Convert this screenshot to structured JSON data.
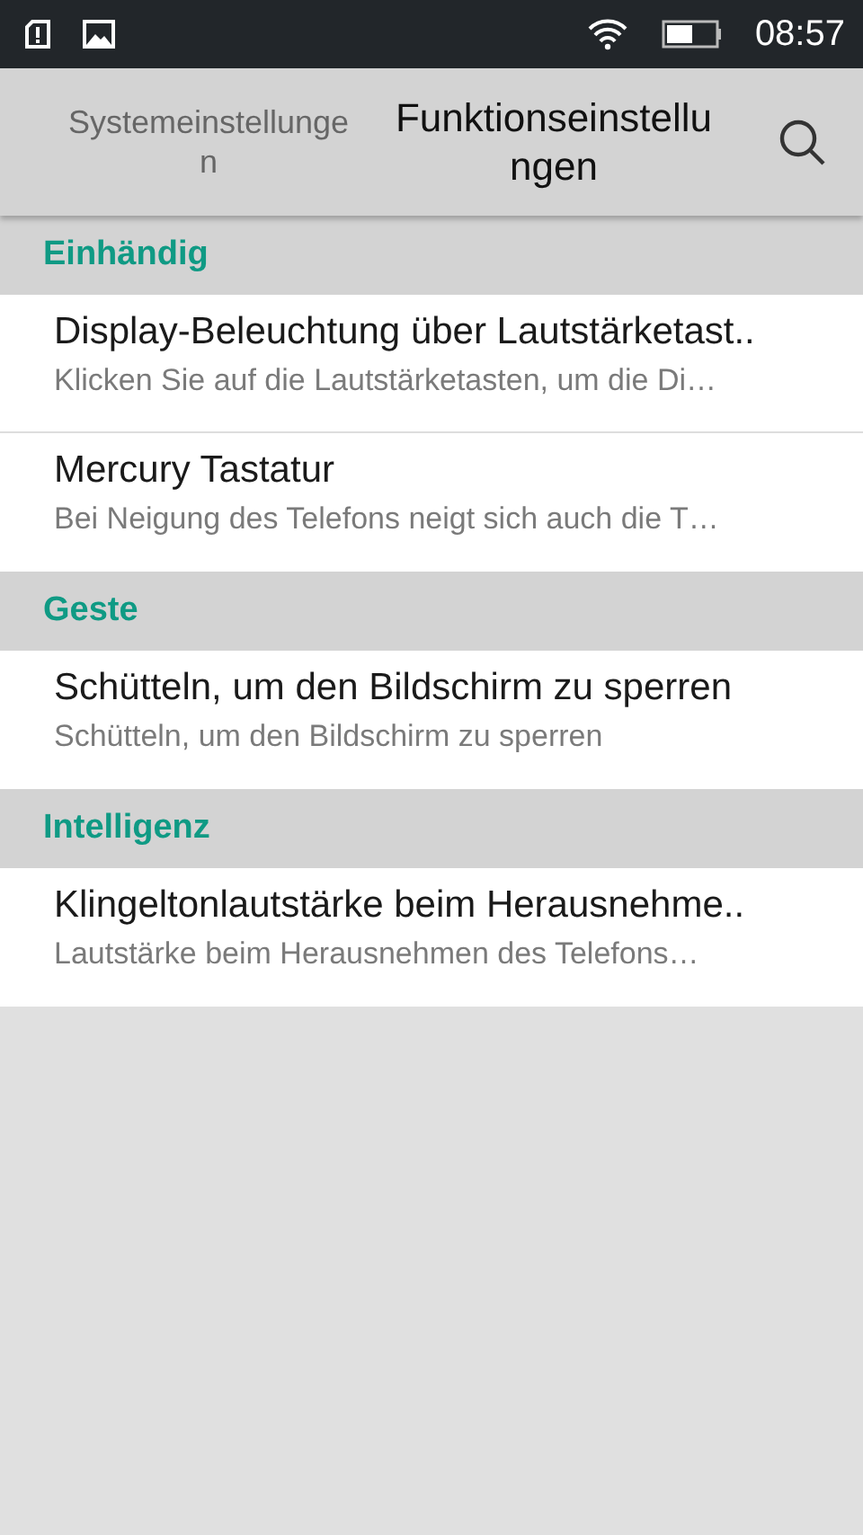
{
  "status_bar": {
    "time": "08:57"
  },
  "tabs": [
    {
      "label": "Systemeinstellungen",
      "selected": false
    },
    {
      "label": "Funktionseinstellungen",
      "selected": true
    }
  ],
  "sections": [
    {
      "title": "Einhändig",
      "items": [
        {
          "title": "Display-Beleuchtung über Lautstärketast..",
          "subtitle": "Klicken Sie auf die Lautstärketasten, um die Di…"
        },
        {
          "title": "Mercury Tastatur",
          "subtitle": "Bei Neigung des Telefons neigt sich auch die T…"
        }
      ]
    },
    {
      "title": "Geste",
      "items": [
        {
          "title": "Schütteln, um den Bildschirm zu sperren",
          "subtitle": "Schütteln, um den Bildschirm zu sperren"
        }
      ]
    },
    {
      "title": "Intelligenz",
      "items": [
        {
          "title": "Klingeltonlautstärke beim Herausnehme..",
          "subtitle": "Lautstärke beim Herausnehmen des Telefons…"
        }
      ]
    }
  ]
}
